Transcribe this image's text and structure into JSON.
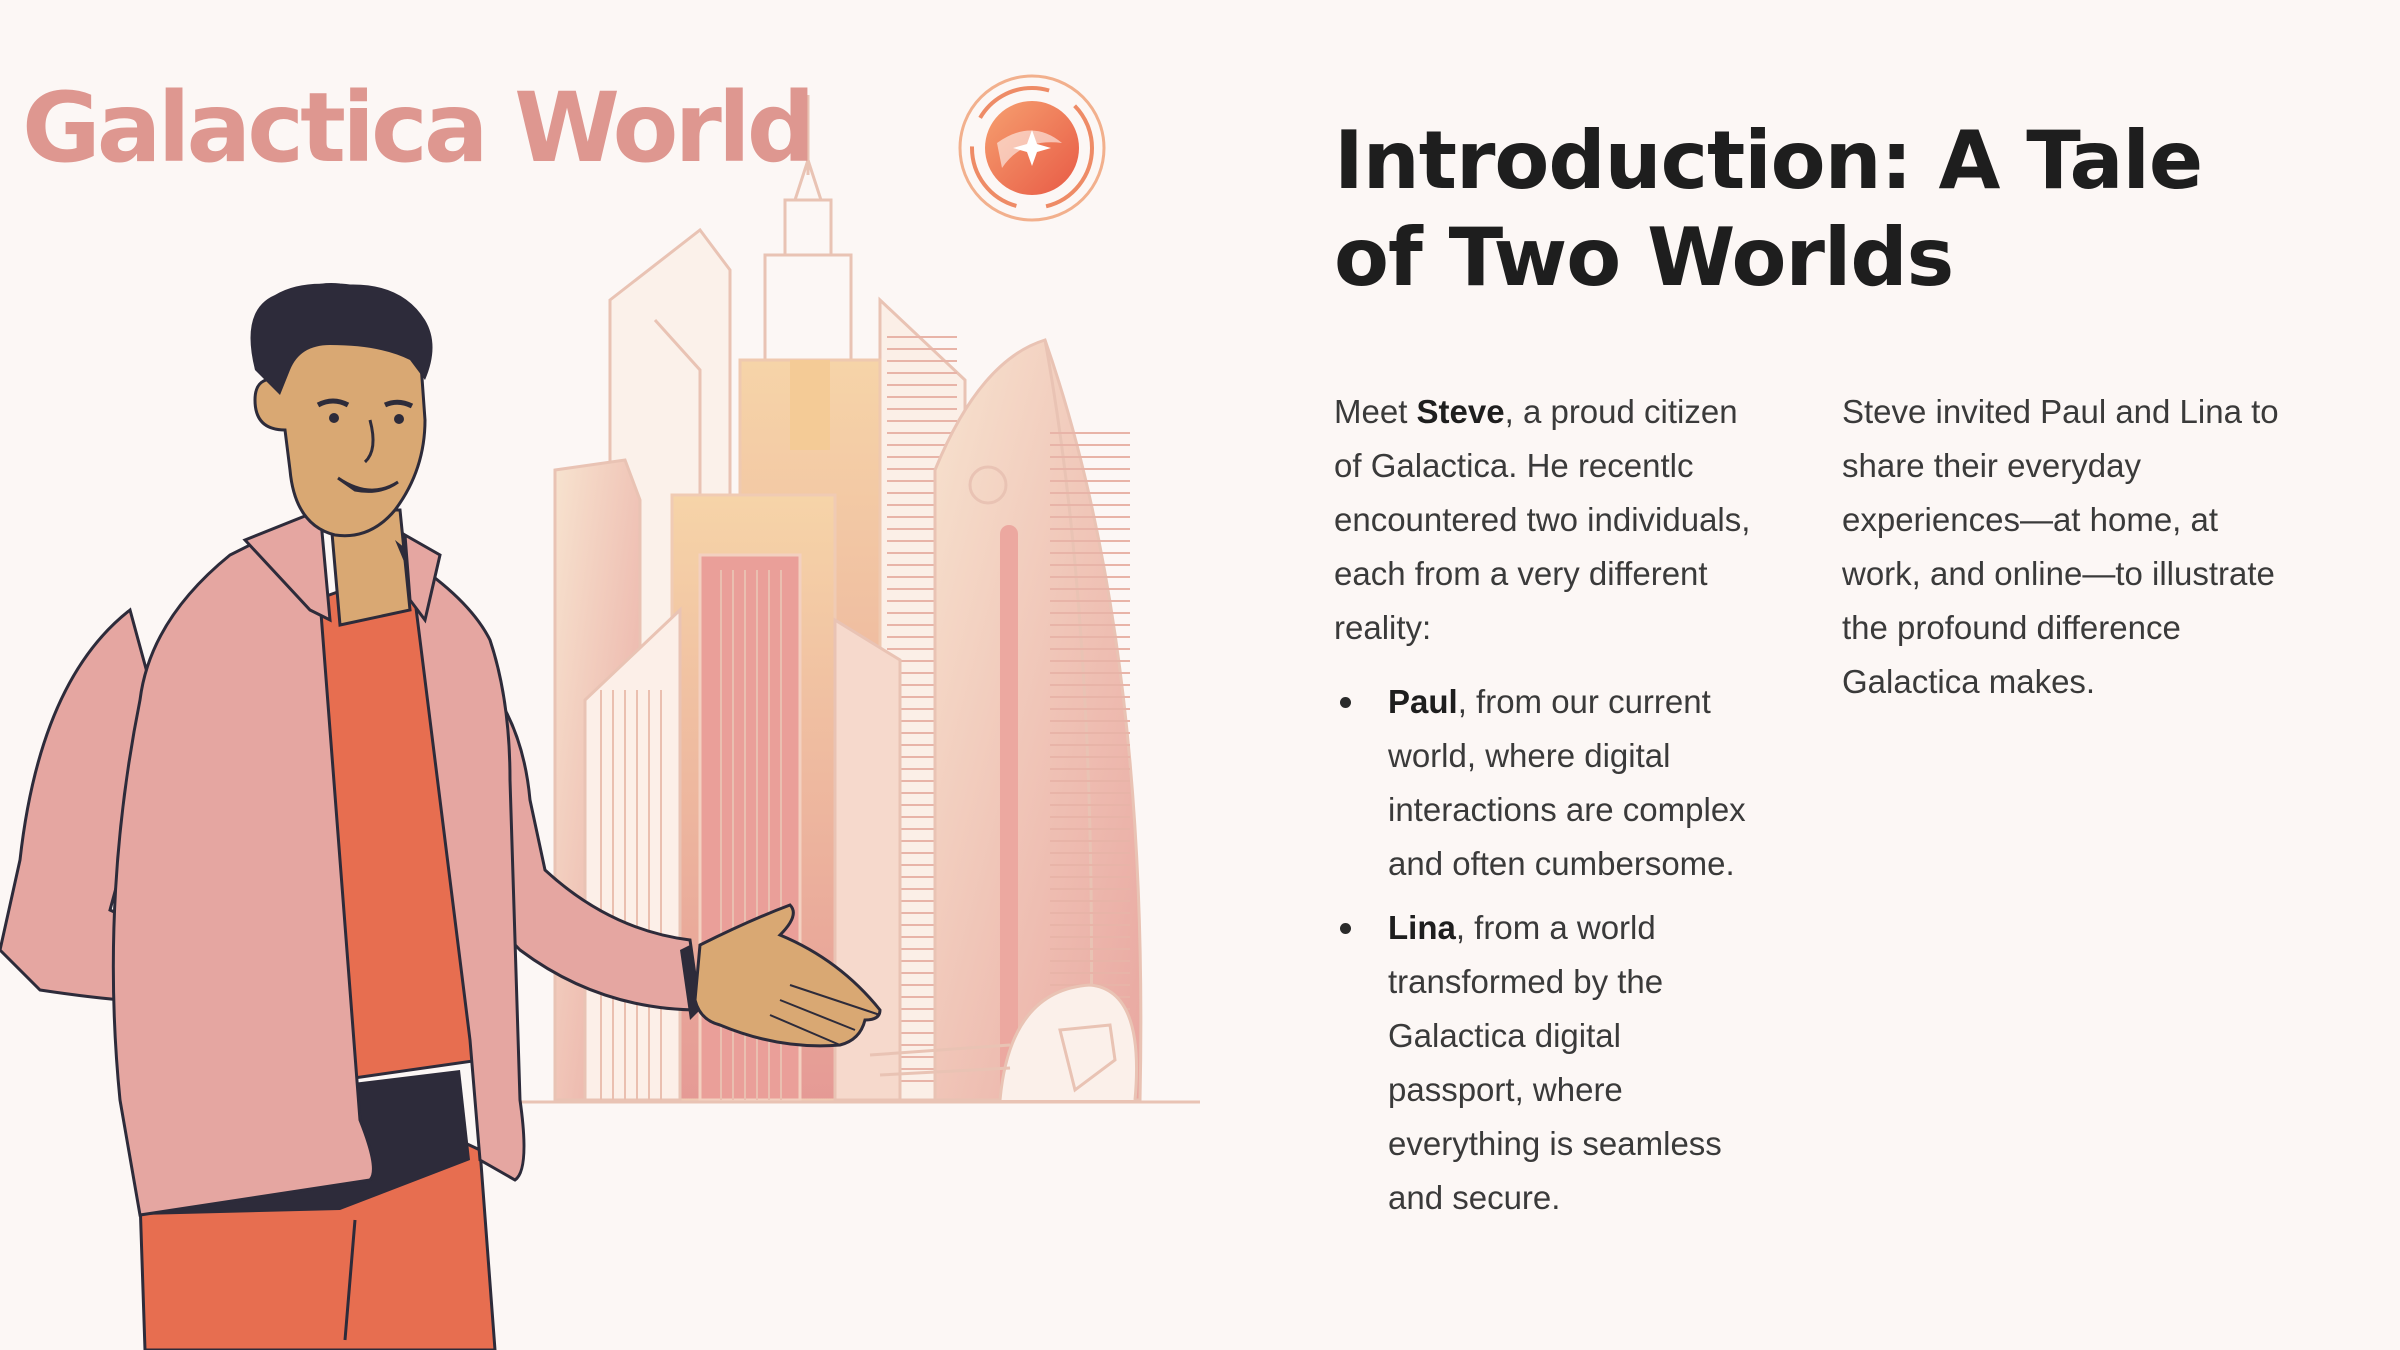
{
  "slide": {
    "brand": "Galactica World",
    "title": "Introduction: A Tale of Two Worlds",
    "intro": {
      "meet": "Meet ",
      "name": "Steve",
      "rest": ", a proud citizen of Galactica. He recentlc encountered two individuals, each from a very different reality:"
    },
    "people": [
      {
        "name": "Paul",
        "description": ", from our current world, where digital interactions are complex and often cumbersome."
      },
      {
        "name": "Lina",
        "description": ", from a world transformed by the Galactica digital passport, where everything is seamless and secure."
      }
    ],
    "side_paragraph": "Steve invited Paul and Lina to share their everyday experiences—at home, at work, and online—to illustrate the profound difference Galactica makes."
  },
  "colors": {
    "background": "#fcf7f5",
    "brand_text": "#de9790",
    "accent_orange": "#e76e50",
    "jacket_pink": "#e5a6a1",
    "skin": "#d9a873",
    "hair": "#2d2b3a",
    "heading_text": "#1e1e1e",
    "body_text": "#3a3a3a"
  }
}
